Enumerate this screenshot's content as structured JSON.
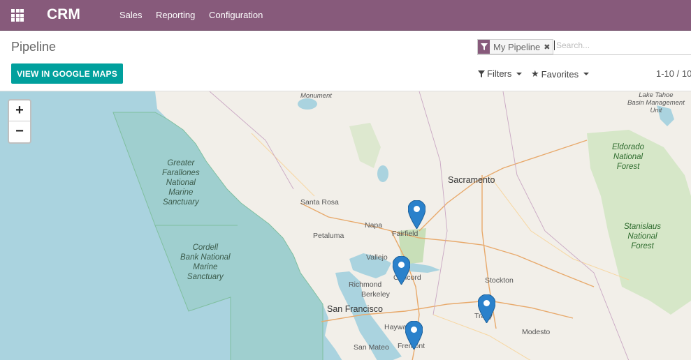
{
  "navbar": {
    "brand": "CRM",
    "menu": [
      "Sales",
      "Reporting",
      "Configuration"
    ],
    "color": "#875A7B"
  },
  "breadcrumb": "Pipeline",
  "buttons": {
    "google_maps": "VIEW IN GOOGLE MAPS",
    "google_maps_color": "#00A09D"
  },
  "search": {
    "facet_value": "My Pipeline",
    "facet_icon": "filter-icon",
    "placeholder": "Search..."
  },
  "filters_label": "Filters",
  "favorites_label": "Favorites",
  "pager": "1-10 / 10",
  "map": {
    "zoom_in": "+",
    "zoom_out": "−",
    "places": {
      "monument": "Monument",
      "lake_tahoe": [
        "Lake Tahoe",
        "Basin Management",
        "Unit"
      ],
      "farallones": [
        "Greater",
        "Farallones",
        "National",
        "Marine",
        "Sanctuary"
      ],
      "cordell": [
        "Cordell",
        "Bank National",
        "Marine",
        "Sanctuary"
      ],
      "eldorado": [
        "Eldorado",
        "National",
        "Forest"
      ],
      "stanislaus": [
        "Stanislaus",
        "National",
        "Forest"
      ],
      "sacramento": "Sacramento",
      "santa_rosa": "Santa Rosa",
      "napa": "Napa",
      "fairfield": "Fairfield",
      "petaluma": "Petaluma",
      "vallejo": "Vallejo",
      "concord": "Concord",
      "richmond": "Richmond",
      "berkeley": "Berkeley",
      "san_francisco": "San Francisco",
      "stockton": "Stockton",
      "tracy": "Tracy",
      "hayward": "Hayward",
      "fremont": "Fremont",
      "modesto": "Modesto",
      "san_mateo": "San Mateo"
    },
    "marker_color": "#2A81CB",
    "water_color": "#AAD3DF",
    "land_color": "#F2EFE9"
  }
}
